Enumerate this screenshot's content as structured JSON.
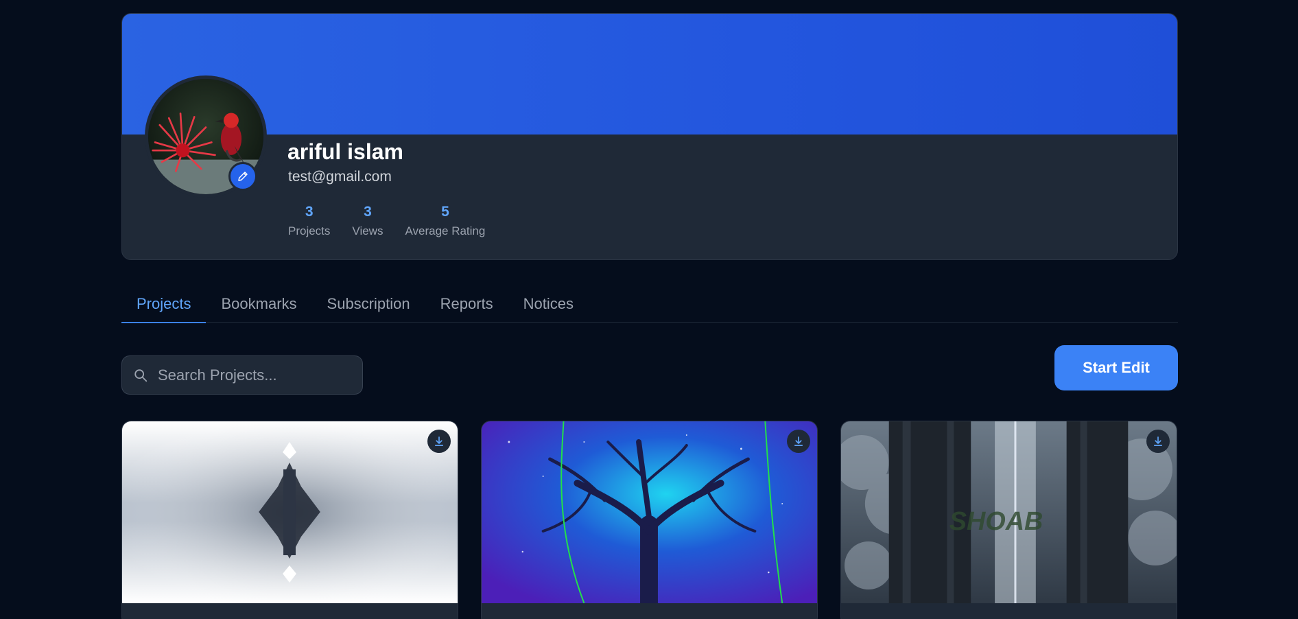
{
  "profile": {
    "name": "ariful islam",
    "email": "test@gmail.com",
    "stats": [
      {
        "value": "3",
        "label": "Projects"
      },
      {
        "value": "3",
        "label": "Views"
      },
      {
        "value": "5",
        "label": "Average Rating"
      }
    ]
  },
  "tabs": [
    {
      "label": "Projects",
      "active": true
    },
    {
      "label": "Bookmarks",
      "active": false
    },
    {
      "label": "Subscription",
      "active": false
    },
    {
      "label": "Reports",
      "active": false
    },
    {
      "label": "Notices",
      "active": false
    }
  ],
  "toolbar": {
    "search_placeholder": "Search Projects...",
    "start_edit_label": "Start Edit"
  },
  "projects": [
    {
      "thumbnail": "symmetric-abstract-art",
      "watermark": ""
    },
    {
      "thumbnail": "cosmic-tree-art",
      "watermark": ""
    },
    {
      "thumbnail": "stone-pillars-storm-art",
      "watermark": "SHOAB"
    }
  ],
  "colors": {
    "background": "#050d1c",
    "card": "#1f2937",
    "cover": "#2356de",
    "accent": "#3b82f6",
    "stat_value": "#60a5fa"
  }
}
